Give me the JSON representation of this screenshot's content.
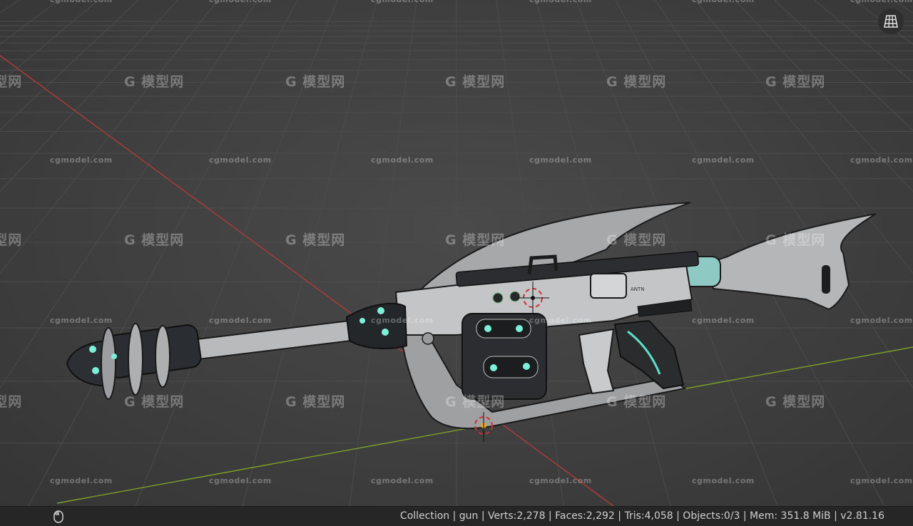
{
  "watermark": {
    "site": "cgmodel.com",
    "brand_glyph": "G",
    "brand_text": "模型网"
  },
  "viewport": {
    "icons": {
      "grid_toggle": "grid-floor-icon",
      "origin": "object-origin-icon",
      "cursor": "3d-cursor-icon"
    },
    "colors": {
      "x_axis": "#b23a3a",
      "y_axis": "#7ea02a",
      "origin": "#f0a020"
    }
  },
  "statusbar": {
    "mouse_icon": "mouse-icon",
    "text": "Collection | gun | Verts:2,278 | Faces:2,292 | Tris:4,058 | Objects:0/3 | Mem: 351.8 MiB | v2.81.16"
  },
  "model": {
    "barrel_marking": "ANTN"
  }
}
